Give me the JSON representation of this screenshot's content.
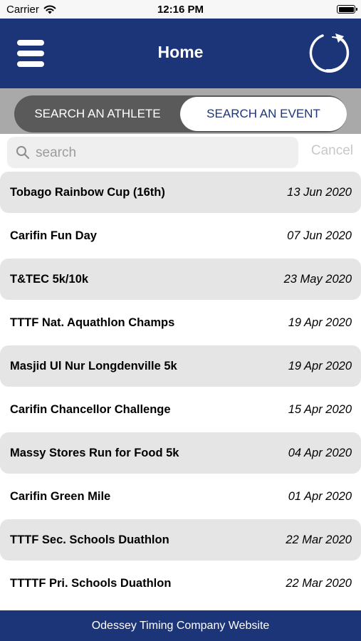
{
  "status_bar": {
    "carrier": "Carrier",
    "time": "12:16 PM"
  },
  "nav": {
    "title": "Home",
    "menu_icon": "hamburger-menu-icon",
    "logo_icon": "odessey-logo-icon"
  },
  "segments": {
    "left": "SEARCH AN ATHLETE",
    "right": "SEARCH AN EVENT",
    "selected": "SEARCH AN EVENT"
  },
  "search": {
    "placeholder": "search",
    "value": "",
    "cancel": "Cancel"
  },
  "events": [
    {
      "name": "Tobago Rainbow Cup (16th)",
      "date": "13 Jun 2020"
    },
    {
      "name": "Carifin Fun Day",
      "date": "07 Jun 2020"
    },
    {
      "name": "T&TEC 5k/10k",
      "date": "23 May 2020"
    },
    {
      "name": "TTTF Nat. Aquathlon Champs",
      "date": "19 Apr 2020"
    },
    {
      "name": "Masjid Ul Nur Longdenville 5k",
      "date": "19 Apr 2020"
    },
    {
      "name": "Carifin Chancellor Challenge",
      "date": "15 Apr 2020"
    },
    {
      "name": "Massy Stores Run for Food 5k",
      "date": "04 Apr 2020"
    },
    {
      "name": "Carifin Green Mile",
      "date": "01 Apr 2020"
    },
    {
      "name": "TTTF Sec. Schools Duathlon",
      "date": "22 Mar 2020"
    },
    {
      "name": "TTTTF Pri. Schools Duathlon",
      "date": "22 Mar 2020"
    }
  ],
  "footer": {
    "link": "Odessey Timing Company Website"
  },
  "colors": {
    "brand_blue": "#1c3578",
    "row_gray": "#e5e5e5",
    "segment_dark": "#5a5a5a"
  }
}
